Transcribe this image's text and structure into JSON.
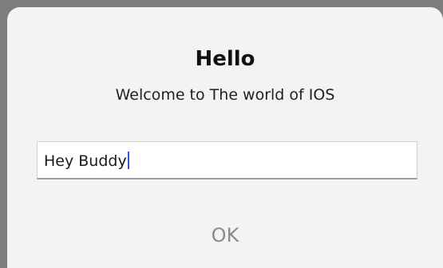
{
  "alert": {
    "title": "Hello",
    "message": "Welcome to The world of IOS",
    "input_value": "Hey Buddy",
    "ok_label": "OK"
  }
}
